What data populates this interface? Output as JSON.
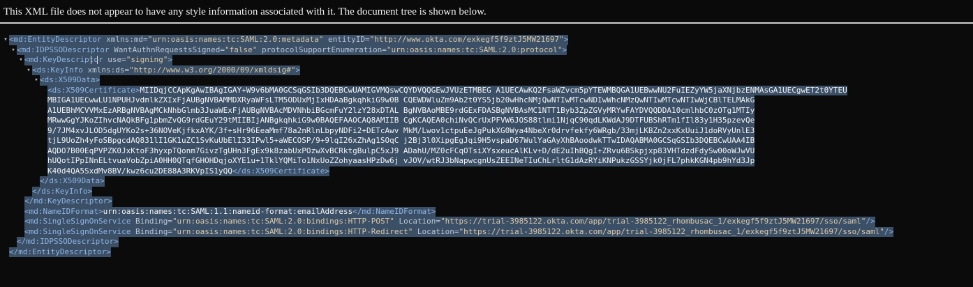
{
  "banner": "This XML file does not appear to have any style information associated with it. The document tree is shown below.",
  "toggle": "▾",
  "lines": [
    {
      "indent": 0,
      "tog": true,
      "parts": [
        {
          "c": "tag",
          "t": "<md:EntityDescriptor "
        },
        {
          "c": "attr",
          "t": "xmlns:md="
        },
        {
          "c": "val",
          "t": "\"urn:oasis:names:tc:SAML:2.0:metadata\""
        },
        {
          "c": "attr",
          "t": " entityID="
        },
        {
          "c": "val",
          "t": "\"http://www.okta.com/exkegf5f9ztJ5MW21697\""
        },
        {
          "c": "tag",
          "t": ">"
        }
      ]
    },
    {
      "indent": 1,
      "tog": true,
      "parts": [
        {
          "c": "tag",
          "t": "<md:IDPSSODescriptor "
        },
        {
          "c": "attr",
          "t": "WantAuthnRequestsSigned="
        },
        {
          "c": "val",
          "t": "\"false\""
        },
        {
          "c": "attr",
          "t": " protocolSupportEnumeration="
        },
        {
          "c": "val",
          "t": "\"urn:oasis:names:tc:SAML:2.0:protocol\""
        },
        {
          "c": "tag",
          "t": ">"
        }
      ]
    },
    {
      "indent": 2,
      "tog": true,
      "parts": [
        {
          "c": "tag",
          "t": "<md:KeyDescriptor "
        },
        {
          "c": "attr",
          "t": "use="
        },
        {
          "c": "val",
          "t": "\"signing\""
        },
        {
          "c": "tag",
          "t": ">"
        }
      ]
    },
    {
      "indent": 3,
      "tog": true,
      "parts": [
        {
          "c": "tag",
          "t": "<ds:KeyInfo "
        },
        {
          "c": "attr",
          "t": "xmlns:ds="
        },
        {
          "c": "val",
          "t": "\"http://www.w3.org/2000/09/xmldsig#\""
        },
        {
          "c": "tag",
          "t": ">"
        }
      ]
    },
    {
      "indent": 4,
      "tog": true,
      "parts": [
        {
          "c": "tag",
          "t": "<ds:X509Data>"
        }
      ]
    },
    {
      "indent": 5,
      "tog": false,
      "parts": [
        {
          "c": "tag",
          "t": "<ds:X509Certificate>"
        },
        {
          "c": "txt",
          "t": "MIIDqjCCApKgAwIBAgIGAY+W9v6bMA0GCSqGSIb3DQEBCwUAMIGVMQswCQYDVQQGEwJVUzETMBEG A1UECAwKQ2FsaWZvcm5pYTEWMBQGA1UEBwwNU2FuIEZyYW5jaXNjbzENMAsGA1UECgwET2t0YTEU"
        }
      ]
    },
    {
      "indent": 5,
      "tog": false,
      "parts": [
        {
          "c": "txt",
          "t": "MBIGA1UECwwLU1NPUHJvdmlkZXIxFjAUBgNVBAMMDXRyaWFsLTM5ODUxMjIxHDAaBgkqhkiG9w0B CQEWDWluZm9Ab2t0YS5jb20wHhcNMjQwNTIwMTcwNDIwWhcNMzQwNTIwMTcwNTIwWjCBlTELMAkG"
        }
      ]
    },
    {
      "indent": 5,
      "tog": false,
      "parts": [
        {
          "c": "txt",
          "t": "A1UEBhMCVVMxEzARBgNVBAgMCkNhbGlmb3JuaWExFjAUBgNVBAcMDVNhbiBGcmFuY2lzY28xDTAL BgNVBAoMBE9rdGExFDASBgNVBAsMC1NTT1Byb3ZpZGVyMRYwFAYDVQQDDA10cmlhbC0zOTg1MTIy"
        }
      ]
    },
    {
      "indent": 5,
      "tog": false,
      "parts": [
        {
          "c": "txt",
          "t": "MRwwGgYJKoZIhvcNAQkBFg1pbmZvQG9rdGEuY29tMIIBIjANBgkqhkiG9w0BAQEFAAOCAQ8AMIIB CgKCAQEA0chiNvQCrUxPFVW6JOS88tlmi1NjqC90qdLKWdAJ9DTFUBShRTm1fIl83y1H35pzevQe"
        }
      ]
    },
    {
      "indent": 5,
      "tog": false,
      "parts": [
        {
          "c": "txt",
          "t": "9/7JM4xvJLOD5dgUYKo2s+36NOVeKjfkxAYK/3f+sHr96EeaMmf78a2nRlnLbpyNDFi2+DETcAwv MkM/Lwov1ctpuEeJgPukXG0Wya4NbeXr0drvfekfy6WRgb/33mjLKBZn2xxKxUuiJ1doRVyUnlE3"
        }
      ]
    },
    {
      "indent": 5,
      "tog": false,
      "parts": [
        {
          "c": "txt",
          "t": "tjL9UoZh4yFoSBpgcdAQ831lI1GK1uZC1SvKuUbElI33IPwl5+aWECOSP/9+9lqI26xZhAg1SOqC j2Bj3l0XipgEgJqi9H5vspaD67WulYaGAyXhBAoodwkTTwIDAQABMA0GCSqGSIb3DQEBCwUAA4IB"
        }
      ]
    },
    {
      "indent": 5,
      "tog": false,
      "parts": [
        {
          "c": "txt",
          "t": "AQDO7B00EqPVPZK0JxKtoF3hyxpTQonm7GivzTgUHn3FgEx9k8zabUxPOzwXvBCRktgBulpC5xJ9 ADahU/MZ0cFCqOTsiXYsxeucAlKLv+D/dE2uIhBQgI+ZRvu6BSkpjxp83VHTdzdFdySw00oWJwVU"
        }
      ]
    },
    {
      "indent": 5,
      "tog": false,
      "parts": [
        {
          "c": "txt",
          "t": "hUQotIPpINnELtvuaVobZpiA0HH0QTqfGHOHDqjoXYE1u+1TklYQMiTo1NxUoZZohyaasHPzDw6j vJOV/wtRJ3bNapwcgnUsZEEINeTIuChLrltG1dAzRYiKNPukzGSSYjk0jFL7phkKGN4pb9hYd3Jp"
        }
      ]
    },
    {
      "indent": 5,
      "tog": false,
      "parts": [
        {
          "c": "txt",
          "t": "K40d4QA5SxdMv8BV/kwz6cu2DE88A3RKVpIS1yQQ"
        },
        {
          "c": "tag",
          "t": "</ds:X509Certificate>"
        }
      ]
    },
    {
      "indent": 4,
      "tog": false,
      "parts": [
        {
          "c": "tag",
          "t": "</ds:X509Data>"
        }
      ]
    },
    {
      "indent": 3,
      "tog": false,
      "parts": [
        {
          "c": "tag",
          "t": "</ds:KeyInfo>"
        }
      ]
    },
    {
      "indent": 2,
      "tog": false,
      "parts": [
        {
          "c": "tag",
          "t": "</md:KeyDescriptor>"
        }
      ]
    },
    {
      "indent": 2,
      "tog": false,
      "parts": [
        {
          "c": "tag",
          "t": "<md:NameIDFormat>"
        },
        {
          "c": "txt",
          "t": "urn:oasis:names:tc:SAML:1.1:nameid-format:emailAddress"
        },
        {
          "c": "tag",
          "t": "</md:NameIDFormat>"
        }
      ]
    },
    {
      "indent": 2,
      "tog": false,
      "parts": [
        {
          "c": "tag",
          "t": "<md:SingleSignOnService "
        },
        {
          "c": "attr",
          "t": "Binding="
        },
        {
          "c": "val",
          "t": "\"urn:oasis:names:tc:SAML:2.0:bindings:HTTP-POST\""
        },
        {
          "c": "attr",
          "t": " Location="
        },
        {
          "c": "val",
          "t": "\"https://trial-3985122.okta.com/app/trial-3985122_rhombusac_1/exkegf5f9ztJ5MW21697/sso/saml\""
        },
        {
          "c": "tag",
          "t": "/>"
        }
      ]
    },
    {
      "indent": 2,
      "tog": false,
      "parts": [
        {
          "c": "tag",
          "t": "<md:SingleSignOnService "
        },
        {
          "c": "attr",
          "t": "Binding="
        },
        {
          "c": "val",
          "t": "\"urn:oasis:names:tc:SAML:2.0:bindings:HTTP-Redirect\""
        },
        {
          "c": "attr",
          "t": " Location="
        },
        {
          "c": "val",
          "t": "\"https://trial-3985122.okta.com/app/trial-3985122_rhombusac_1/exkegf5f9ztJ5MW21697/sso/saml\""
        },
        {
          "c": "tag",
          "t": "/>"
        }
      ]
    },
    {
      "indent": 1,
      "tog": false,
      "parts": [
        {
          "c": "tag",
          "t": "</md:IDPSSODescriptor>"
        }
      ]
    },
    {
      "indent": 0,
      "tog": false,
      "parts": [
        {
          "c": "tag",
          "t": "</md:EntityDescriptor>"
        }
      ]
    }
  ]
}
